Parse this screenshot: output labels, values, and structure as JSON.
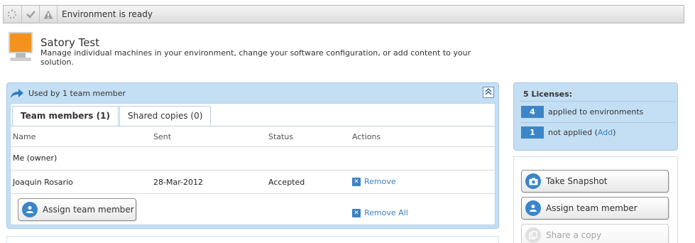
{
  "status_bar": {
    "text": "Environment is ready",
    "icons": [
      "spinner-icon",
      "check-icon",
      "warning-icon"
    ]
  },
  "header": {
    "title": "Satory Test",
    "description": "Manage individual machines in your environment, change your software configuration, or add content to your solution."
  },
  "team_panel": {
    "title": "Used by 1 team member",
    "tabs": [
      {
        "label": "Team members (1)",
        "active": true
      },
      {
        "label": "Shared copies (0)",
        "active": false
      }
    ],
    "columns": [
      "Name",
      "Sent",
      "Status",
      "Actions"
    ],
    "rows": [
      {
        "name": "Me (owner)",
        "sent": "",
        "status": "",
        "action": ""
      },
      {
        "name": "Joaquin Rosario",
        "sent": "28-Mar-2012",
        "status": "Accepted",
        "action": "Remove"
      }
    ],
    "assign_button": "Assign team member",
    "remove_all": "Remove All"
  },
  "licenses": {
    "title": "5 Licenses:",
    "applied_count": "4",
    "applied_label": "applied to environments",
    "not_applied_count": "1",
    "not_applied_label": "not applied (",
    "add_link": "Add",
    "close_paren": ")"
  },
  "side_actions": {
    "snapshot": "Take Snapshot",
    "assign": "Assign team member",
    "share": "Share a copy"
  },
  "colors": {
    "accent": "#3c86c7",
    "panel_bg": "#c4dff4",
    "monitor": "#f4921e"
  }
}
